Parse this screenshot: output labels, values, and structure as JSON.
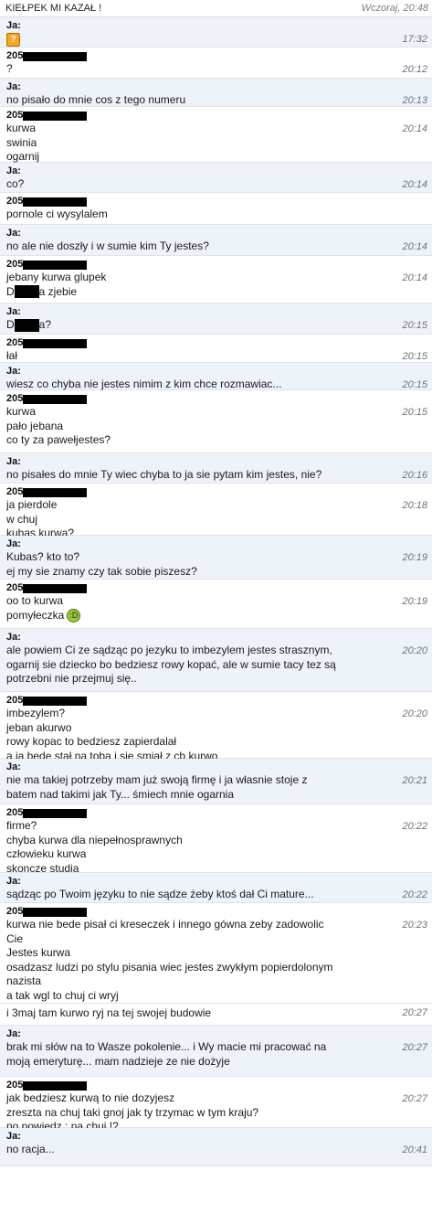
{
  "header": {
    "title": "KIEŁPEK MI KAZAŁ !",
    "date": "Wczoraj, 20:48"
  },
  "messages": [
    {
      "from": "me",
      "sender": "Ja:",
      "time": "17:32",
      "emoji": "?",
      "lines": []
    },
    {
      "from": "them",
      "sender": "205",
      "time": "20:12",
      "lines": [
        "?"
      ]
    },
    {
      "from": "me",
      "sender": "Ja:",
      "time": "20:13",
      "lines": [
        "no pisało do mnie cos z tego numeru"
      ]
    },
    {
      "from": "them",
      "sender": "205",
      "time": "20:14",
      "lines": [
        "kurwa",
        "swinia",
        "ogarnij"
      ]
    },
    {
      "from": "me",
      "sender": "Ja:",
      "time": "20:14",
      "lines": [
        "co?"
      ]
    },
    {
      "from": "them",
      "sender": "205",
      "time": "",
      "lines": [
        "pornole ci wysylalem"
      ]
    },
    {
      "from": "me",
      "sender": "Ja:",
      "time": "20:14",
      "lines": [
        "no ale nie doszły i w sumie kim Ty jestes?"
      ]
    },
    {
      "from": "them",
      "sender": "205",
      "time": "20:14",
      "lines": [
        "jebany kurwa glupek"
      ],
      "redacted_line": {
        "before": "D",
        "after": "a zjebie"
      }
    },
    {
      "from": "me",
      "sender": "Ja:",
      "time": "20:15",
      "redacted_line": {
        "before": "D",
        "after": "a?"
      },
      "lines": []
    },
    {
      "from": "them",
      "sender": "205",
      "time": "20:15",
      "lines": [
        "łał"
      ]
    },
    {
      "from": "me",
      "sender": "Ja:",
      "time": "20:15",
      "lines": [
        "wiesz co chyba nie jestes nimim z kim chce rozmawiac..."
      ]
    },
    {
      "from": "them",
      "sender": "205",
      "time": "20:15",
      "lines": [
        "kurwa",
        "pało jebana",
        "co ty za pawełjestes?"
      ]
    },
    {
      "from": "me",
      "sender": "Ja:",
      "time": "20:16",
      "lines": [
        "no pisałes do mnie Ty wiec chyba to ja sie pytam kim jestes, nie?"
      ]
    },
    {
      "from": "them",
      "sender": "205",
      "time": "20:18",
      "lines": [
        "ja pierdole",
        "w chuj",
        "kubas kurwa?"
      ]
    },
    {
      "from": "me",
      "sender": "Ja:",
      "time": "20:19",
      "lines": [
        "Kubas? kto to?",
        "ej my sie znamy czy tak sobie piszesz?"
      ]
    },
    {
      "from": "them",
      "sender": "205",
      "time": "20:19",
      "lines": [
        "oo to kurwa",
        "pomyłeczka"
      ],
      "smiley": ":D"
    },
    {
      "from": "me",
      "sender": "Ja:",
      "time": "20:20",
      "lines": [
        "ale powiem Ci ze sądząc po jezyku to imbezylem jestes strasznym,",
        "ogarnij sie dziecko bo bedziesz rowy kopać, ale w sumie tacy tez są",
        "potrzebni nie przejmuj się.."
      ]
    },
    {
      "from": "them",
      "sender": "205",
      "time": "20:20",
      "lines": [
        "imbezylem?",
        "jeban akurwo",
        "rowy kopac to bedziesz zapierdalał",
        "a ja bede stał na toba i sie smiał z cb kurwo"
      ]
    },
    {
      "from": "me",
      "sender": "Ja:",
      "time": "20:21",
      "lines": [
        "nie ma takiej potrzeby mam już swoją firmę i ja własnie stoje z",
        "batem nad takimi jak Ty... śmiech mnie ogarnia"
      ]
    },
    {
      "from": "them",
      "sender": "205",
      "time": "20:22",
      "lines": [
        "firme?",
        "chyba kurwa dla niepełnosprawnych",
        "człowieku kurwa",
        "skoncze studia"
      ]
    },
    {
      "from": "me",
      "sender": "Ja:",
      "time": "20:22",
      "lines": [
        "sądząc po Twoim języku to nie sądze żeby ktoś dał Ci mature..."
      ]
    },
    {
      "from": "them",
      "sender": "205",
      "time": "20:23",
      "lines": [
        "kurwa nie bede pisał ci kreseczek i innego gówna zeby zadowolic",
        "Cie",
        "Jestes kurwa",
        "osadzasz ludzi po stylu pisania wiec jestes zwykłym popierdolonym",
        "nazista",
        "a tak wgl to chuj ci wryj"
      ]
    },
    {
      "from": "them",
      "sender": "",
      "time": "20:27",
      "lines": [
        "i 3maj tam kurwo ryj na tej swojej budowie"
      ]
    },
    {
      "from": "me",
      "sender": "Ja:",
      "time": "20:27",
      "lines": [
        "brak mi słów na to Wasze pokolenie... i Wy macie mi pracować na",
        "moją emeryturę... mam nadzieje ze nie dożyje"
      ]
    },
    {
      "from": "them",
      "sender": "205",
      "time": "20:27",
      "lines": [
        "jak bedziesz kurwą to nie dozyjesz",
        "zreszta na chuj taki gnoj jak ty trzymac w tym kraju?",
        "no powiedz : na chuj !?"
      ]
    },
    {
      "from": "me",
      "sender": "Ja:",
      "time": "20:41",
      "lines": [
        "no racja..."
      ]
    }
  ]
}
